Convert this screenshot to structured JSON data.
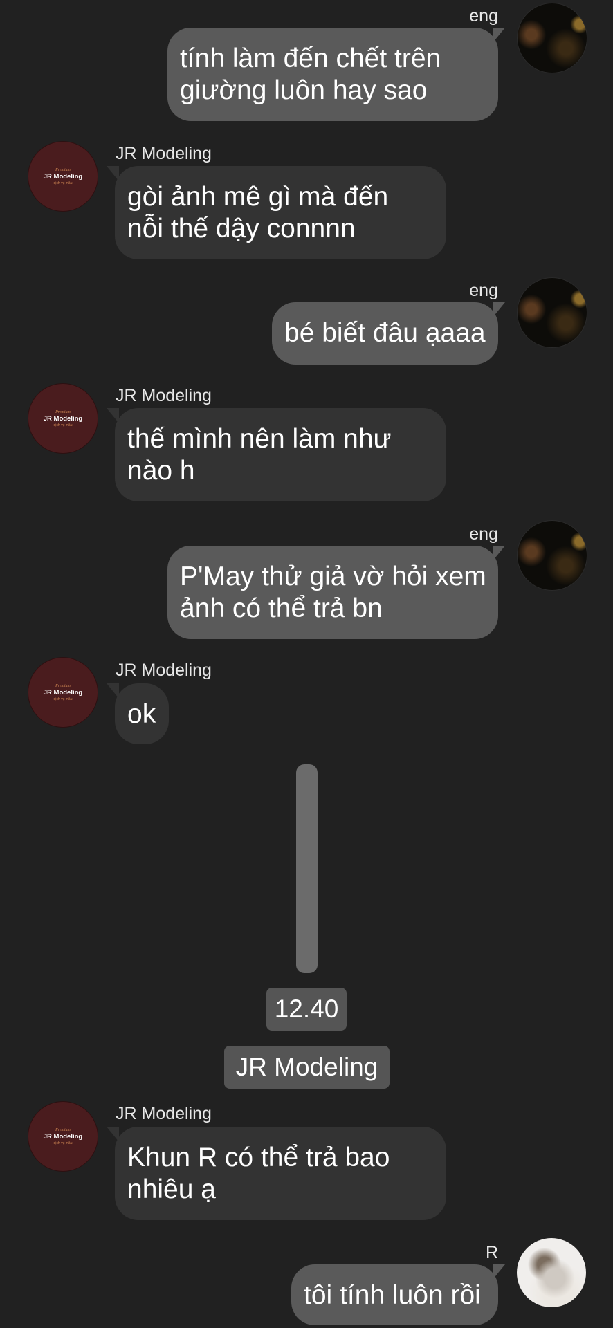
{
  "chat": {
    "messages": [
      {
        "sender": "eng",
        "direction": "outgoing",
        "lines": [
          "tính làm đến chết trên",
          "giường luôn hay sao"
        ]
      },
      {
        "sender": "JR Modeling",
        "direction": "incoming",
        "lines": [
          "gòi ảnh mê gì mà đến",
          "nỗi thế dậy connnn"
        ]
      },
      {
        "sender": "eng",
        "direction": "outgoing",
        "lines": [
          "bé biết đâu ạaaa"
        ]
      },
      {
        "sender": "JR Modeling",
        "direction": "incoming",
        "lines": [
          "thế mình nên làm như",
          "nào h"
        ]
      },
      {
        "sender": "eng",
        "direction": "outgoing",
        "lines": [
          "P'May thử giả vờ hỏi xem",
          "ảnh có thể trả bn"
        ]
      },
      {
        "sender": "JR Modeling",
        "direction": "incoming",
        "lines": [
          "ok"
        ]
      },
      {
        "sender": "JR Modeling",
        "direction": "incoming",
        "lines": [
          "Khun R có thể trả bao",
          "nhiêu ạ"
        ]
      },
      {
        "sender": "R",
        "direction": "outgoing",
        "lines": [
          "tôi tính luôn rồi"
        ]
      }
    ],
    "time_pill": "12.40",
    "name_pill": "JR Modeling",
    "jr_logo": {
      "top": "Premium",
      "brand": "JR Modeling",
      "tagline": "dịch vụ mẫu"
    },
    "colors": {
      "background": "#212121",
      "outgoing_bubble": "#5a5a5a",
      "incoming_bubble": "#333333",
      "pill": "#555555",
      "logo_bg": "#4a1c1e"
    }
  }
}
